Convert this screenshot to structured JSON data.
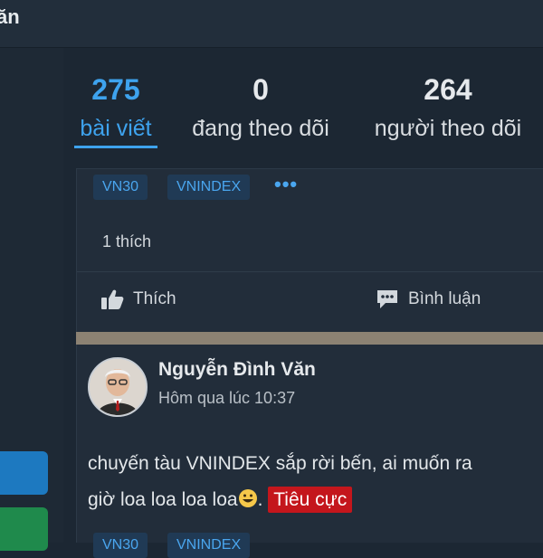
{
  "header": {
    "title": "ăn"
  },
  "stats": [
    {
      "count": "275",
      "label": "bài viết"
    },
    {
      "count": "0",
      "label": "đang theo dõi"
    },
    {
      "count": "264",
      "label": "người theo dõi"
    }
  ],
  "post1": {
    "tags": [
      "VN30",
      "VNINDEX"
    ],
    "more": "•••",
    "likes": "1 thích",
    "like_label": "Thích",
    "comment_label": "Bình luận"
  },
  "post2": {
    "author": "Nguyễn Đình Văn",
    "time": "Hôm qua lúc 10:37",
    "line1": "chuyến tàu VNINDEX sắp rời bến, ai muốn ra",
    "line2_text": "giờ loa loa loa loa",
    "line2_tail": ".",
    "sentiment": "Tiêu cực",
    "tags": [
      "VN30",
      "VNINDEX"
    ]
  }
}
